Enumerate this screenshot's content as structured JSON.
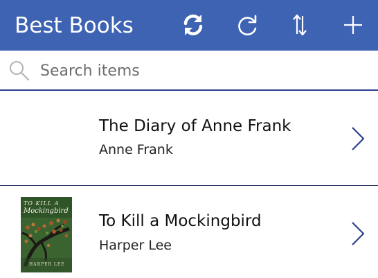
{
  "header": {
    "title": "Best Books",
    "background_color": "#3e63b3",
    "buttons": [
      {
        "name": "refresh-icon"
      },
      {
        "name": "reload-icon"
      },
      {
        "name": "sort-icon"
      },
      {
        "name": "add-icon"
      }
    ]
  },
  "search": {
    "placeholder": "Search items",
    "value": "",
    "icon": "search-icon"
  },
  "items": [
    {
      "title": "The Diary of Anne Frank",
      "subtitle": "Anne Frank",
      "has_image": false
    },
    {
      "title": "To Kill a Mockingbird",
      "subtitle": "Harper Lee",
      "has_image": true,
      "cover": {
        "title_line_1": "TO KILL A",
        "title_line_2": "Mockingbird",
        "author": "HARPER LEE"
      }
    }
  ],
  "colors": {
    "accent": "#3e63b3",
    "chevron": "#2a3f8f"
  }
}
